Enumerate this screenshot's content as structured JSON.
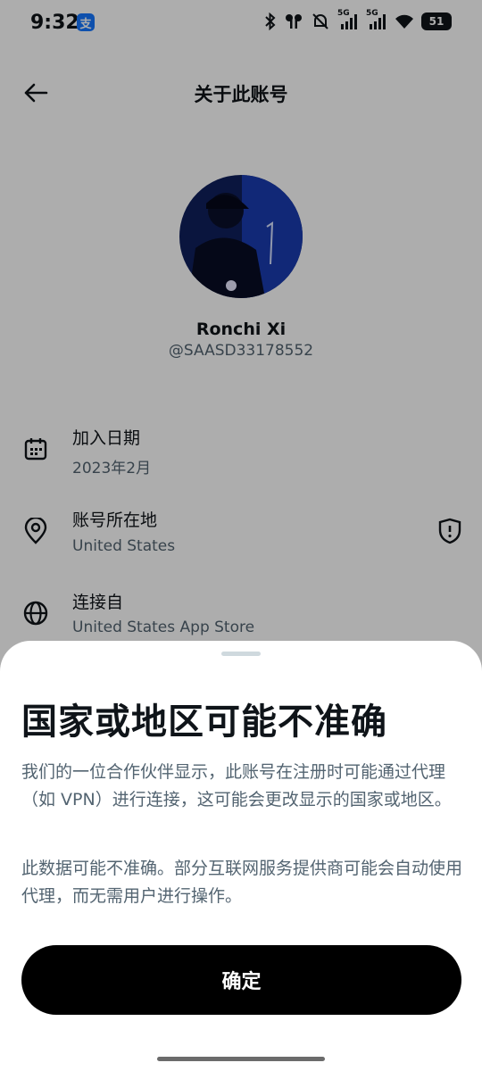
{
  "status_bar": {
    "time": "9:32",
    "app_badge": "支",
    "network_1": "5G",
    "network_2": "5G",
    "battery": "51"
  },
  "header": {
    "title": "关于此账号",
    "back_icon": "arrow-left-icon"
  },
  "profile": {
    "name": "Ronchi Xi",
    "handle": "@SAASD33178552"
  },
  "info_rows": [
    {
      "icon": "calendar-icon",
      "title": "加入日期",
      "value": "2023年2月"
    },
    {
      "icon": "location-pin-icon",
      "title": "账号所在地",
      "value": "United States"
    },
    {
      "icon": "globe-icon",
      "title": "连接自",
      "value": "United States App Store"
    }
  ],
  "sheet": {
    "title": "国家或地区可能不准确",
    "paragraph_1": "我们的一位合作伙伴显示，此账号在注册时可能通过代理（如 VPN）进行连接，这可能会更改显示的国家或地区。",
    "paragraph_2": "此数据可能不准确。部分互联网服务提供商可能会自动使用代理，而无需用户进行操作。",
    "confirm_label": "确定"
  },
  "colors": {
    "primary_text": "#0f1419",
    "secondary_text": "#536471",
    "button_bg": "#000000",
    "overlay": "rgba(0,0,0,0.32)"
  }
}
